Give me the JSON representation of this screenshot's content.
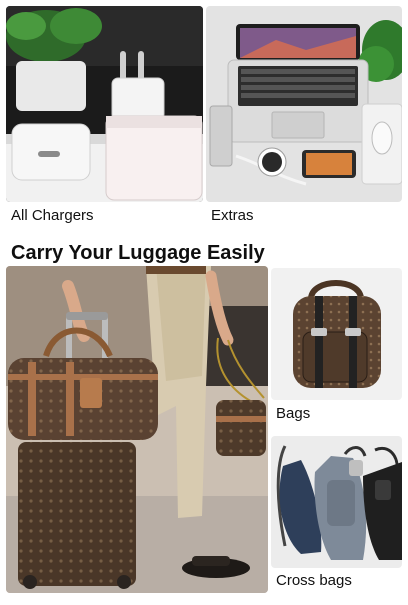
{
  "top_row": {
    "left": {
      "label": "All Chargers",
      "image": "usb-c-wall-charger-photo"
    },
    "right": {
      "label": "Extras",
      "image": "laptop-accessories-flatlay-photo"
    }
  },
  "section": {
    "title": "Carry Your Luggage Easily",
    "hero": {
      "image": "woman-with-luggage-and-handbag-photo"
    },
    "items": [
      {
        "label": "Bags",
        "image": "monogram-backpack-photo"
      },
      {
        "label": "Cross bags",
        "image": "sling-crossbody-bags-photo"
      }
    ]
  }
}
